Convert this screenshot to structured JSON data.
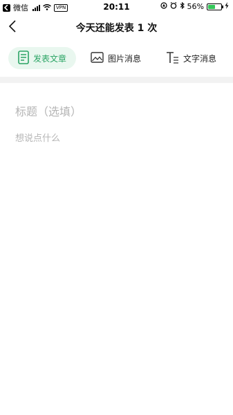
{
  "status_bar": {
    "app_back_label": "微信",
    "vpn_label": "VPN",
    "time": "20:11",
    "battery_percent": "56%",
    "battery_level": 0.56
  },
  "nav": {
    "title": "今天还能发表 1 次"
  },
  "tabs": [
    {
      "label": "发表文章",
      "icon": "document-icon",
      "active": true
    },
    {
      "label": "图片消息",
      "icon": "image-icon",
      "active": false
    },
    {
      "label": "文字消息",
      "icon": "text-icon",
      "active": false
    }
  ],
  "editor": {
    "title_placeholder": "标题（选填）",
    "body_placeholder": "想说点什么"
  },
  "colors": {
    "accent": "#2aa464",
    "accent_bg": "#e9f7ef",
    "placeholder": "#b5b5b5",
    "divider": "#f2f2f2"
  }
}
